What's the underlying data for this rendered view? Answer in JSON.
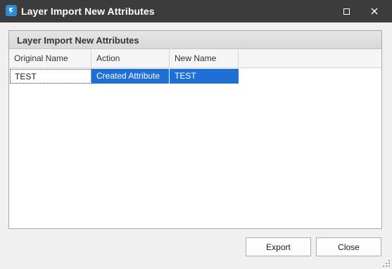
{
  "window": {
    "title": "Layer Import New Attributes",
    "icon": "app-logo-icon",
    "controls": [
      "maximize-icon",
      "close-icon"
    ]
  },
  "panel": {
    "title": "Layer Import New Attributes"
  },
  "table": {
    "columns": [
      "Original Name",
      "Action",
      "New Name"
    ],
    "rows": [
      {
        "original_name": "TEST",
        "action": "Created Attribute",
        "new_name": "TEST"
      }
    ],
    "selected_row": 0
  },
  "buttons": {
    "export": "Export",
    "close": "Close"
  },
  "colors": {
    "titlebar": "#3c3c3c",
    "selection": "#1e6fd6",
    "app_icon": "#2b8cd8"
  }
}
